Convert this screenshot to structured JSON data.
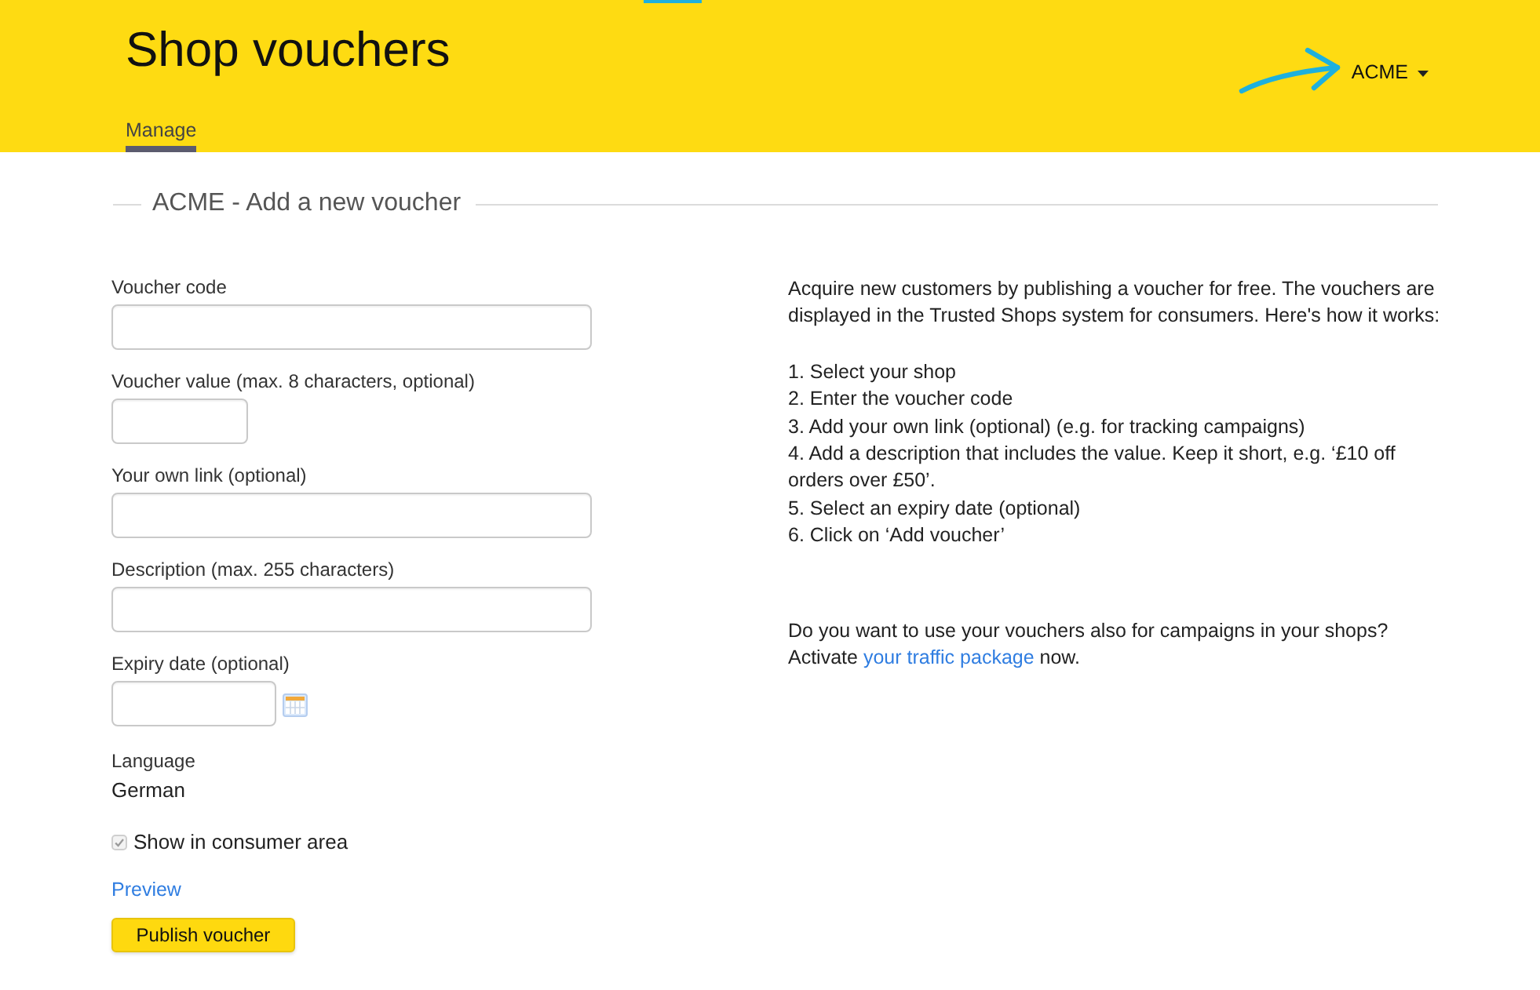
{
  "header": {
    "title": "Shop vouchers",
    "account": "ACME",
    "tabs": [
      {
        "label": "Manage",
        "selected": true
      }
    ]
  },
  "section": {
    "title": "ACME - Add a new voucher"
  },
  "form": {
    "fields": [
      {
        "kind": "text",
        "label": "Voucher code"
      },
      {
        "kind": "short",
        "label": "Voucher value (max. 8 characters, optional)"
      },
      {
        "kind": "text",
        "label": "Your own link (optional)"
      },
      {
        "kind": "text",
        "label": "Description (max. 255 characters)"
      },
      {
        "kind": "date",
        "label": "Expiry date (optional)"
      },
      {
        "kind": "static",
        "label": "Language",
        "value": "German"
      }
    ],
    "consumer_area": {
      "label": "Show in consumer area",
      "checked": true,
      "disabled": true
    },
    "preview_link": "Preview",
    "submit": "Publish voucher"
  },
  "info": {
    "intro": "Acquire new customers by publishing a voucher for free. The vouchers are displayed in the Trusted Shops system for consumers. Here's how it works:",
    "steps": [
      "1. Select your shop",
      "2. Enter the voucher code",
      "3. Add your own link (optional) (e.g. for tracking campaigns)",
      "4. Add a description that includes the value. Keep it short, e.g. ‘£10 off orders over £50’.",
      "5. Select an expiry date (optional)",
      "6. Click on ‘Add voucher’"
    ],
    "question": "Do you want to use your vouchers also for campaigns in your shops?",
    "cta": {
      "before": "Activate",
      "link": "your traffic package",
      "after": "now."
    }
  }
}
